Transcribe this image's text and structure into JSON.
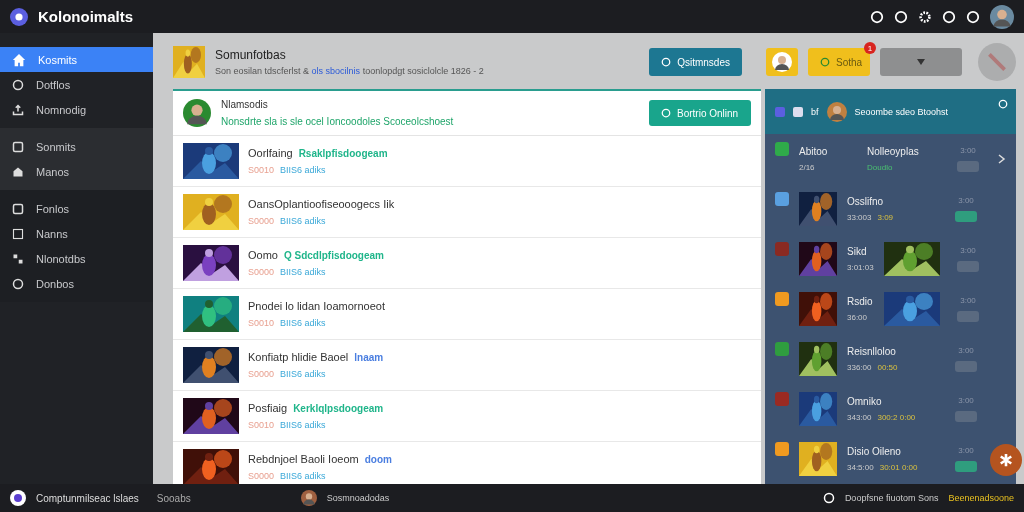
{
  "app": {
    "title": "Kolonoimalts"
  },
  "sidebar": {
    "groups": [
      {
        "items": [
          {
            "label": "Kosmits",
            "selected": true
          },
          {
            "label": "Dotflos",
            "selected": false
          },
          {
            "label": "Nomnodig",
            "selected": false
          }
        ]
      },
      {
        "items": [
          {
            "label": "Sonmits",
            "selected": false
          },
          {
            "label": "Manos",
            "selected": false
          }
        ]
      },
      {
        "items": [
          {
            "label": "Fonlos",
            "selected": false
          },
          {
            "label": "Nanns",
            "selected": false
          },
          {
            "label": "Nlonotdbs",
            "selected": false
          },
          {
            "label": "Donbos",
            "selected": false
          }
        ]
      }
    ]
  },
  "header": {
    "title": "Somunfotbas",
    "subtitle_before": "Son eosilan tdscferlst &",
    "subtitle_link": "ols sbocilnis",
    "subtitle_after": "toonlopdgt sosiclolcle 1826 -",
    "subtitle_end": "2",
    "primary_button": "Qsitmnsdes",
    "yellow_button": "Sotha",
    "badge": "1"
  },
  "feed": {
    "name": "Nlamsodis",
    "status": "Nonsdrte sla is sle ocel Ioncoodoles Scoceolcshoest",
    "button": "Bortrio Onlinn",
    "games": [
      {
        "title": "Oorlfaing",
        "tag": "Rsaklpfisdoogeam",
        "price": "S0010",
        "info": "BIIS6 adiks",
        "color": "#1fb58a"
      },
      {
        "title": "OansOplantioofiseooogecs Iik",
        "price": "S0000",
        "info": "BIIS6 adiks"
      },
      {
        "title": "Oomo",
        "tag": "Q Sdcdlpfisdoogeam",
        "price": "S0000",
        "info": "BIIS6 adiks",
        "color": "#1fb58a"
      },
      {
        "title": "Pnodei lo lidan Ioamornoeot",
        "price": "S0010",
        "info": "BIIS6 adiks"
      },
      {
        "title": "Konfiatp hlidie Baoel",
        "tag": "lnaam",
        "price": "S0000",
        "info": "BIIS6 adiks",
        "color": "#4a7ee0"
      },
      {
        "title": "Posfiaig",
        "tag": "Kerklqlpsdoogeam",
        "price": "S0010",
        "info": "BIIS6 adiks",
        "color": "#1fb58a"
      },
      {
        "title": "Rebdnjoel Baoli Ioeom",
        "tag": "doom",
        "price": "S0000",
        "info": "BIIS6 adiks",
        "color": "#4a7ee0"
      }
    ]
  },
  "panel": {
    "header_text": "Seoombe sdeo Btoohst",
    "header_tag": "bf",
    "rows": [
      {
        "kind": "summary",
        "color": "#2faa4a",
        "title": "Abitoo",
        "sub": "2/16",
        "name": "Nolleoyplas",
        "note": "Doudlo",
        "time": "3:00",
        "active": false
      },
      {
        "kind": "game",
        "color": "#5aa0e0",
        "title": "Osslifno",
        "sub": "33:003",
        "note": "3:09",
        "time": "3:00",
        "active": true
      },
      {
        "kind": "collage",
        "color": "#8a2a22",
        "title": "Sikd",
        "sub": "3:01:03",
        "time": "3:00",
        "active": false
      },
      {
        "kind": "collage",
        "color": "#f09a20",
        "title": "Rsdio",
        "sub": "36:00",
        "time": "3:00",
        "active": false
      },
      {
        "kind": "game",
        "color": "#2f9d3f",
        "title": "Reisnlloloo",
        "sub": "336:00",
        "note": "00:50",
        "time": "3:00",
        "active": false
      },
      {
        "kind": "game",
        "color": "#9a2a22",
        "title": "Omniko",
        "sub": "343:00",
        "note": "300:2 0:00",
        "time": "3:00",
        "active": false
      },
      {
        "kind": "game",
        "color": "#f09a20",
        "title": "Disio Oileno",
        "sub": "34:5:00",
        "note": "30:01 0:00",
        "time": "3:00",
        "active": true
      }
    ]
  },
  "footer": {
    "brand": "Comptunmilseac lslaes",
    "section": "Sooabs",
    "user": "Sosmnoadodas",
    "note": "Doopfsne fiuotom Sons",
    "highlight": "Beenenadsoone"
  }
}
